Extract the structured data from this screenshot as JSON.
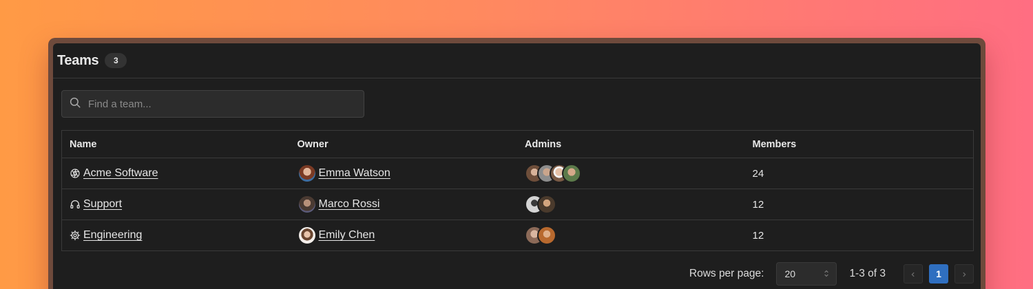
{
  "panel": {
    "title": "Teams",
    "count": "3"
  },
  "search": {
    "placeholder": "Find a team..."
  },
  "table": {
    "columns": [
      "Name",
      "Owner",
      "Admins",
      "Members"
    ],
    "rows": [
      {
        "name": "Acme Software",
        "icon": "aperture-icon",
        "owner": "Emma Watson",
        "owner_avatar_color": "#b5643f",
        "admin_avatar_colors": [
          "#8a6a55",
          "#a48870",
          "#c9a38a",
          "#6f8a5a"
        ],
        "members": "24"
      },
      {
        "name": "Support",
        "icon": "headphones-icon",
        "owner": "Marco Rossi",
        "owner_avatar_color": "#6b5a4e",
        "admin_avatar_colors": [
          "#c8c8c8",
          "#9a7a5a"
        ],
        "members": "12"
      },
      {
        "name": "Engineering",
        "icon": "gear-icon",
        "owner": "Emily Chen",
        "owner_avatar_color": "#e9e2dc",
        "admin_avatar_colors": [
          "#b8a090",
          "#c0783a"
        ],
        "members": "12"
      }
    ]
  },
  "pagination": {
    "rows_per_page_label": "Rows per page:",
    "rows_per_page_value": "20",
    "range": "1-3 of 3",
    "current_page": "1",
    "prev_icon": "chevron-left-icon",
    "next_icon": "chevron-right-icon"
  },
  "colors": {
    "panel_bg": "#1e1e1e",
    "accent": "#2f6fc0",
    "border": "#3a3a3a"
  }
}
